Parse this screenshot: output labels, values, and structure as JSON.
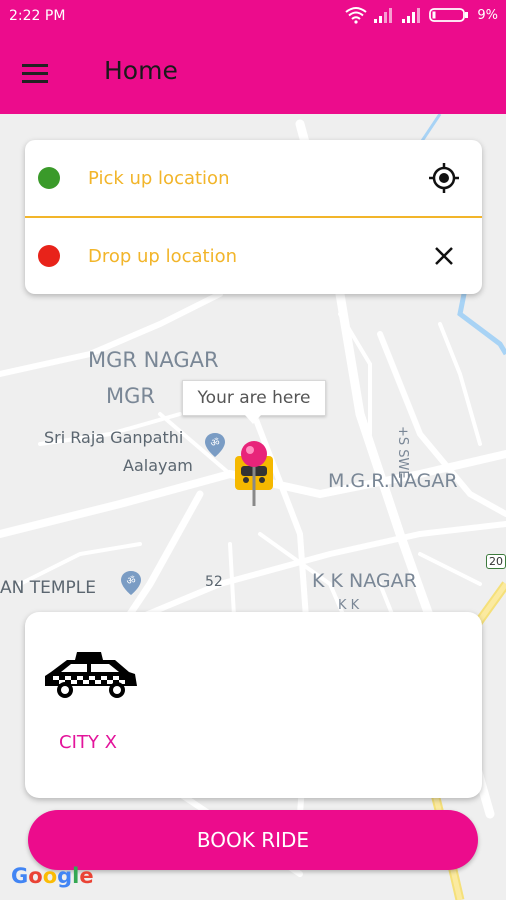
{
  "status_bar": {
    "time": "2:22 PM",
    "battery": "9%"
  },
  "app_bar": {
    "title": "Home",
    "menu_icon": "hamburger-menu-icon"
  },
  "location_panel": {
    "pickup": {
      "label": "Pick up location",
      "dot_color": "#3a9a2a",
      "icon": "gps-target-icon"
    },
    "drop": {
      "label": "Drop up location",
      "dot_color": "#e8231a",
      "icon": "close-icon"
    }
  },
  "map": {
    "labels": [
      "MGR NAGAR",
      "MGR",
      "Sri Raja Ganpathi",
      "Aalayam",
      "M.G.R.NAGAR",
      "K K NAGAR",
      "AN TEMPLE",
      "52",
      "20",
      "K K",
      "+S SWE"
    ],
    "marker_tooltip": "Your are here",
    "provider": "Google"
  },
  "car_options": [
    {
      "name": "CITY X",
      "icon": "taxi-icon"
    }
  ],
  "book_button": {
    "label": "BOOK RIDE"
  },
  "colors": {
    "brand": "#ec0c8c",
    "accent": "#f2b52a",
    "car_label": "#e3149b"
  }
}
